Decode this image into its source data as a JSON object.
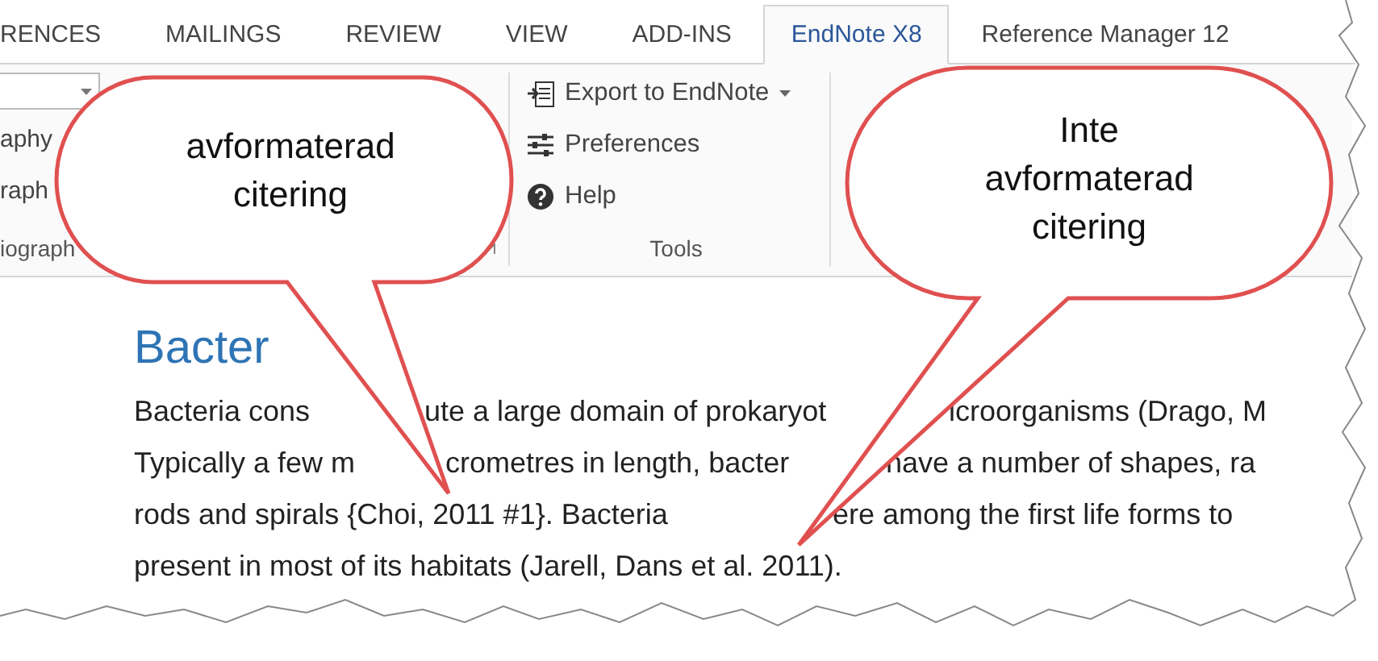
{
  "tabs": [
    {
      "label": "RENCES",
      "selected": false
    },
    {
      "label": "MAILINGS",
      "selected": false
    },
    {
      "label": "REVIEW",
      "selected": false
    },
    {
      "label": "VIEW",
      "selected": false
    },
    {
      "label": "ADD-INS",
      "selected": false
    },
    {
      "label": "EndNote X8",
      "selected": true
    },
    {
      "label": "Reference Manager 12",
      "selected": false
    }
  ],
  "ribbon": {
    "bibliography_group": {
      "items": [
        "aphy",
        "raph"
      ],
      "label": "iograph"
    },
    "tools_group": {
      "items": [
        {
          "kind": "export",
          "label": "Export to EndNote",
          "dropdown": true
        },
        {
          "kind": "preferences",
          "label": "Preferences",
          "dropdown": false
        },
        {
          "kind": "help",
          "label": "Help",
          "dropdown": false
        }
      ],
      "label": "Tools"
    }
  },
  "document": {
    "heading": "Bacter",
    "lines": [
      [
        "Bacteria cons",
        "ute a large domain of prokaryot",
        "icroorganisms (Drago, M"
      ],
      [
        "Typically a few m",
        "crometres in length, bacter",
        "have a number of shapes, ra"
      ],
      [
        "rods and spirals {Choi, 2011 #1}. Bacteria",
        "ere among the first life forms to"
      ],
      [
        "present in most of its habitats (Jarell, Dans et al. 2011)."
      ]
    ]
  },
  "callouts": [
    {
      "text": "avformaterad\ncitering"
    },
    {
      "text": "Inte\navformaterad\ncitering"
    }
  ]
}
